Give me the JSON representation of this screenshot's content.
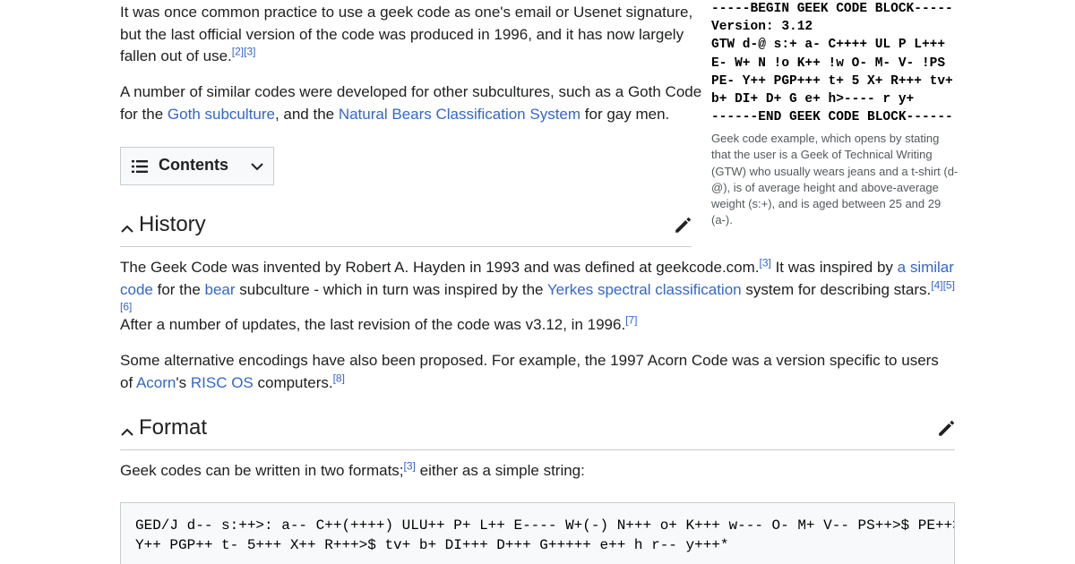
{
  "intro": {
    "p1": {
      "text": "It was once common practice to use a geek code as one's email or Usenet signature, but the last official version of the code was produced in 1996, and it has now largely fallen out of use.",
      "refs": "[2][3]"
    },
    "p2": {
      "before": "A number of similar codes were developed for other subcultures, such as a Goth Code for the ",
      "link1": "Goth subculture",
      "mid": ", and the ",
      "link2": "Natural Bears Classification System",
      "after": " for gay men."
    }
  },
  "geek_block": {
    "lines": [
      "-----BEGIN GEEK CODE BLOCK-----",
      "Version: 3.12",
      "GTW d-@ s:+ a- C++++ UL P L+++",
      "E- W+ N !o K++ !w O- M- V- !PS",
      "PE- Y++ PGP+++ t+ 5 X+ R+++ tv+",
      "b+ DI+ D+ G e+ h>---- r y+",
      "------END GEEK CODE BLOCK------"
    ],
    "caption": "Geek code example, which opens by stating that the user is a Geek of Technical Writing (GTW) who usually wears jeans and a t-shirt (d-@), is of average height and above-average weight (s:+), and is aged between 25 and 29 (a-)."
  },
  "toc": {
    "label": "Contents"
  },
  "history": {
    "heading": "History",
    "p1": {
      "t1": "The Geek Code was invented by Robert A. Hayden in 1993 and was defined at geekcode.com.",
      "r1": "[3]",
      "t2": " It was inspired by ",
      "l1": "a similar code",
      "t3": " for the ",
      "l2": "bear",
      "t4": " subculture - which in turn was inspired by the ",
      "l3": "Yerkes spectral classification",
      "t5": " system for describing stars.",
      "r2": "[4][5][6]"
    },
    "p2": {
      "text": "After a number of updates, the last revision of the code was v3.12, in 1996.",
      "ref": "[7]"
    },
    "p3": {
      "t1": "Some alternative encodings have also been proposed. For example, the 1997 Acorn Code was a version specific to users of ",
      "l1": "Acorn",
      "t2": "'s ",
      "l2": "RISC OS",
      "t3": " computers.",
      "ref": "[8]"
    }
  },
  "format": {
    "heading": "Format",
    "p1": {
      "t1": "Geek codes can be written in two formats;",
      "ref": "[3]",
      "t2": " either as a simple string:"
    },
    "code_lines": [
      "GED/J d-- s:++>: a-- C++(++++) ULU++ P+ L++ E---- W+(-) N+++ o+ K+++ w--- O- M+ V-- PS++>$ PE++>$",
      "Y++ PGP++ t- 5+++ X++ R+++>$ tv+ b+ DI+++ D+++ G+++++ e++ h r-- y+++*"
    ]
  },
  "icons": {
    "toc_list": "list-icon",
    "toc_toggle": "chevron-down-icon",
    "collapse": "chevron-up-icon",
    "edit": "pencil-icon"
  },
  "colors": {
    "link": "#3366cc",
    "text": "#202122",
    "border": "#c8ccd1",
    "caption": "#54595d"
  }
}
